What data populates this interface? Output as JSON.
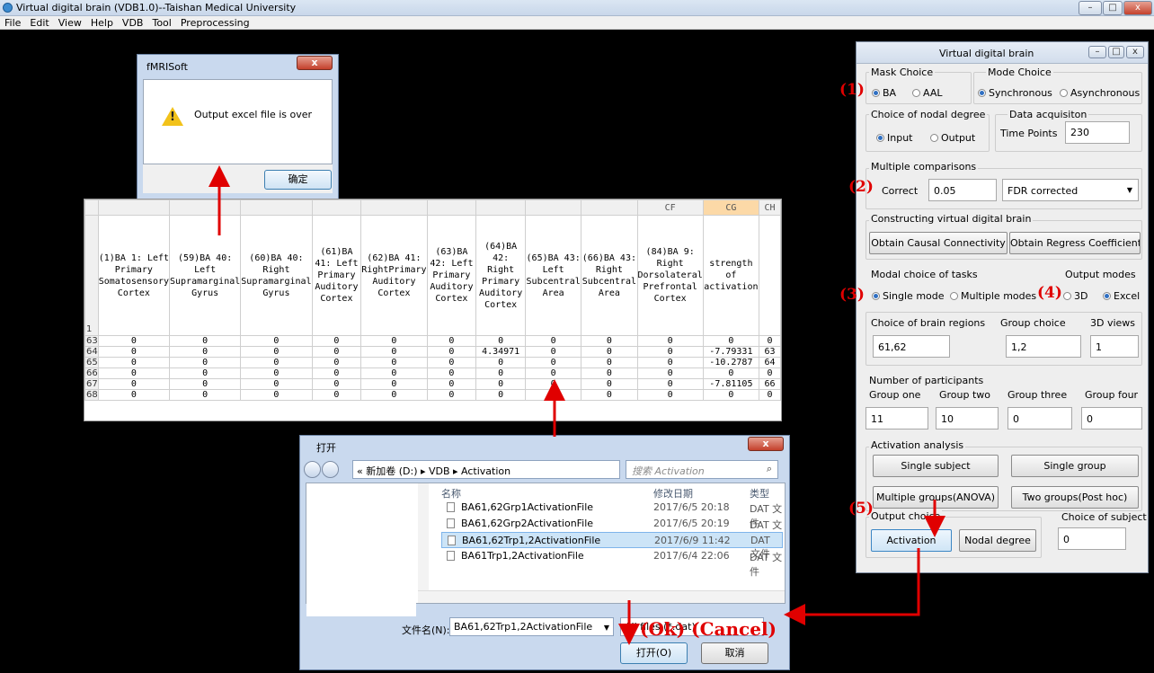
{
  "window": {
    "title": "Virtual digital brain (VDB1.0)--Taishan Medical University"
  },
  "menu": [
    "File",
    "Edit",
    "View",
    "Help",
    "VDB",
    "Tool",
    "Preprocessing"
  ],
  "alert": {
    "title": "fMRISoft",
    "message": "Output excel file is over",
    "ok_label": "确定",
    "close": "x"
  },
  "sheet": {
    "col_letters": [
      "",
      "",
      "",
      "",
      "",
      "",
      "",
      "",
      "",
      "",
      "CF",
      "CG",
      "CH"
    ],
    "headers": [
      "(1)BA 1: Left Primary Somatosensory Cortex",
      "(59)BA 40: Left Supramarginal Gyrus",
      "(60)BA 40: Right Supramarginal Gyrus",
      "(61)BA 41: Left Primary Auditory Cortex",
      "(62)BA 41: RightPrimary Auditory Cortex",
      "(63)BA 42: Left Primary Auditory Cortex",
      "(64)BA 42: Right Primary Auditory Cortex",
      "(65)BA 43: Left Subcentral Area",
      "(66)BA 43: Right Subcentral Area",
      "(84)BA 9: Right Dorsolateral Prefrontal Cortex",
      "strength of activation",
      ""
    ],
    "header_row_num": "1",
    "rows": [
      {
        "n": "63",
        "cells": [
          "0",
          "0",
          "0",
          "0",
          "0",
          "0",
          "0",
          "0",
          "0",
          "0",
          "0",
          "0"
        ]
      },
      {
        "n": "64",
        "cells": [
          "0",
          "0",
          "0",
          "0",
          "0",
          "0",
          "4.34971",
          "0",
          "0",
          "0",
          "-7.79331",
          "63"
        ]
      },
      {
        "n": "65",
        "cells": [
          "0",
          "0",
          "0",
          "0",
          "0",
          "0",
          "0",
          "0",
          "0",
          "0",
          "-10.2787",
          "64"
        ]
      },
      {
        "n": "66",
        "cells": [
          "0",
          "0",
          "0",
          "0",
          "0",
          "0",
          "0",
          "0",
          "0",
          "0",
          "0",
          "0"
        ]
      },
      {
        "n": "67",
        "cells": [
          "0",
          "0",
          "0",
          "0",
          "0",
          "0",
          "0",
          "0",
          "0",
          "0",
          "-7.81105",
          "66"
        ]
      },
      {
        "n": "68",
        "cells": [
          "0",
          "0",
          "0",
          "0",
          "0",
          "0",
          "0",
          "0",
          "0",
          "0",
          "0",
          "0"
        ]
      }
    ]
  },
  "vdb": {
    "title": "Virtual  digital  brain",
    "mask_choice": "Mask Choice",
    "mask_ba": "BA",
    "mask_aal": "AAL",
    "mode_choice": "Mode Choice",
    "mode_sync": "Synchronous",
    "mode_async": "Asynchronous",
    "nodal_degree": "Choice of nodal degree",
    "nd_input": "Input",
    "nd_output": "Output",
    "data_acq": "Data acquisiton",
    "time_points_label": "Time Points",
    "time_points": "230",
    "multiple_comparisons": "Multiple comparisons",
    "correct_label": "Correct",
    "correct_value": "0.05",
    "fdr": "FDR corrected",
    "constructing": "Constructing virtual digital brain",
    "btn_causal": "Obtain  Causal Connectivity",
    "btn_regress": "Obtain Regress Coefficient",
    "modal_choice": "Modal choice of tasks",
    "single_mode": "Single mode",
    "multiple_modes": "Multiple modes",
    "output_modes": "Output modes",
    "out_3d": "3D",
    "out_excel": "Excel",
    "brain_regions_label": "Choice of brain regions",
    "brain_regions": "61,62",
    "group_choice_label": "Group choice",
    "group_choice": "1,2",
    "views_label": "3D views",
    "views": "1",
    "participants": "Number of participants",
    "group_one": "Group one",
    "group_two": "Group two",
    "group_three": "Group three",
    "group_four": "Group four",
    "g1": "11",
    "g2": "10",
    "g3": "0",
    "g4": "0",
    "activation_analysis": "Activation analysis",
    "btn_single_subject": "Single subject",
    "btn_single_group": "Single group",
    "btn_anova": "Multiple groups(ANOVA)",
    "btn_posthoc": "Two groups(Post hoc)",
    "output_choice": "Output choice",
    "btn_activation": "Activation",
    "btn_nodal": "Nodal degree",
    "choice_subject_label": "Choice of subject",
    "choice_subject": "0"
  },
  "markers": {
    "m1": "(1)",
    "m2": "(2)",
    "m3": "(3)",
    "m4": "(4)",
    "m5": "(5)",
    "ok_cancel": "(Ok) (Cancel)"
  },
  "open_dialog": {
    "title": "打开",
    "path": "« 新加卷 (D:) ▸ VDB ▸ Activation",
    "search_placeholder": "搜索 Activation",
    "col_name": "名称",
    "col_date": "修改日期",
    "col_type": "类型",
    "files": [
      {
        "name": "BA61,62Grp1ActivationFile",
        "date": "2017/6/5 20:18",
        "type": "DAT 文件"
      },
      {
        "name": "BA61,62Grp2ActivationFile",
        "date": "2017/6/5 20:19",
        "type": "DAT 文件"
      },
      {
        "name": "BA61,62Trp1,2ActivationFile",
        "date": "2017/6/9 11:42",
        "type": "DAT 文件"
      },
      {
        "name": "BA61Trp1,2ActivationFile",
        "date": "2017/6/4 22:06",
        "type": "DAT 文件"
      }
    ],
    "filename_label": "文件名(N):",
    "filename": "BA61,62Trp1,2ActivationFile",
    "filetype": "All files (*.dat)",
    "open_label": "打开(O)",
    "cancel_label": "取消"
  },
  "colors": {
    "annotation_red": "#e00000",
    "selection_blue": "#cce4f7",
    "header_highlight": "#fcd9a7"
  }
}
